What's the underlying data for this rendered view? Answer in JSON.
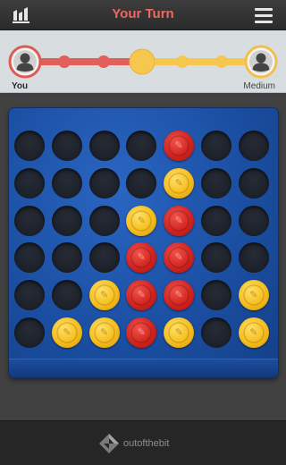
{
  "header": {
    "title": "Your Turn",
    "stats_icon": "stats-icon",
    "menu_icon": "hamburger-menu-icon"
  },
  "progress": {
    "player": {
      "label": "You",
      "avatar_icon": "user-silhouette-icon",
      "color": "#e05a55"
    },
    "opponent": {
      "label": "Medium",
      "avatar_icon": "user-silhouette-icon",
      "color": "#f2c04a"
    },
    "track_colors": {
      "red": "#e35f59",
      "yellow": "#f6c74f"
    },
    "steps": 5,
    "current_step": 3
  },
  "board": {
    "columns": 7,
    "rows": 6,
    "cells": [
      [
        "empty",
        "empty",
        "empty",
        "empty",
        "red",
        "empty",
        "empty"
      ],
      [
        "empty",
        "empty",
        "empty",
        "empty",
        "yellow",
        "empty",
        "empty"
      ],
      [
        "empty",
        "empty",
        "empty",
        "yellow",
        "red",
        "empty",
        "empty"
      ],
      [
        "empty",
        "empty",
        "empty",
        "red",
        "red",
        "empty",
        "empty"
      ],
      [
        "empty",
        "empty",
        "yellow",
        "red",
        "red",
        "empty",
        "yellow"
      ],
      [
        "empty",
        "yellow",
        "yellow",
        "red",
        "yellow",
        "empty",
        "yellow"
      ]
    ],
    "colors": {
      "red": "#d2231f",
      "yellow": "#f5bd1c",
      "board": "#1b4fa3"
    }
  },
  "footer": {
    "brand": "outofthebit",
    "logo_icon": "outofthebit-logo-icon"
  }
}
